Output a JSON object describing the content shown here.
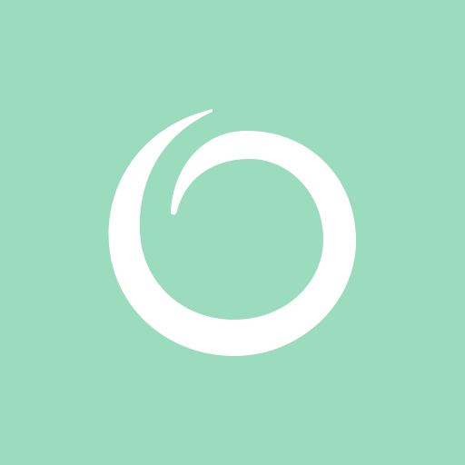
{
  "icon": {
    "name": "swirl-logo-icon",
    "background_color": "#9BDBBE",
    "mark_color": "#FFFFFF"
  }
}
